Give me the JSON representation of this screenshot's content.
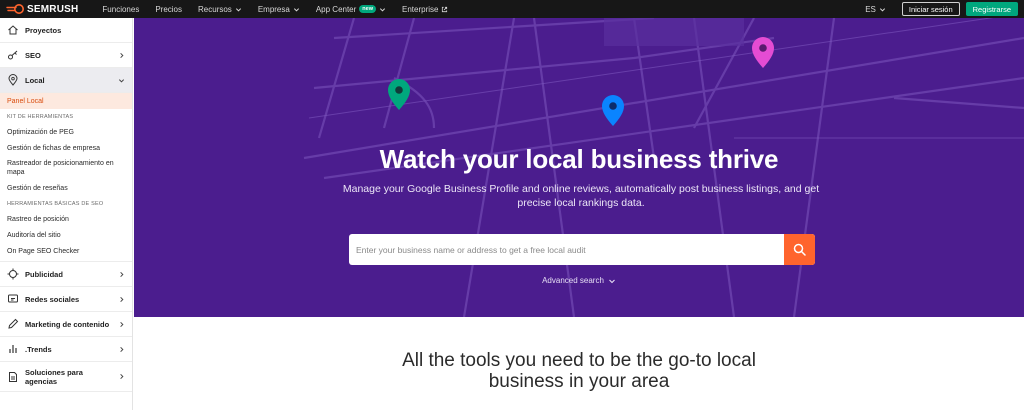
{
  "header": {
    "brand": "SEMRUSH",
    "nav": [
      {
        "label": "Funciones",
        "has_dropdown": false
      },
      {
        "label": "Precios",
        "has_dropdown": false
      },
      {
        "label": "Recursos",
        "has_dropdown": true
      },
      {
        "label": "Empresa",
        "has_dropdown": true
      },
      {
        "label": "App Center",
        "badge": "new",
        "has_dropdown": true
      },
      {
        "label": "Enterprise",
        "external": true
      }
    ],
    "language": "ES",
    "login_label": "Iniciar sesión",
    "register_label": "Registrarse"
  },
  "sidebar": {
    "proyectos": "Proyectos",
    "seo": "SEO",
    "local": "Local",
    "local_items": {
      "panel": "Panel Local",
      "kit_head": "KIT DE HERRAMIENTAS",
      "peg": "Optimización de PEG",
      "fichas": "Gestión de fichas de empresa",
      "rastreador": "Rastreador de posicionamiento en mapa",
      "resenas": "Gestión de reseñas",
      "basic_head": "HERRAMIENTAS BÁSICAS DE SEO",
      "rastreo": "Rastreo de posición",
      "auditoria": "Auditoría del sitio",
      "onpage": "On Page SEO Checker"
    },
    "publicidad": "Publicidad",
    "redes": "Redes sociales",
    "marketing": "Marketing de contenido",
    "trends": ".Trends",
    "soluciones": "Soluciones para agencias"
  },
  "hero": {
    "title": "Watch your local business thrive",
    "subtitle": "Manage your Google Business Profile and online reviews, automatically post business listings, and get precise local rankings data.",
    "search_placeholder": "Enter your business name or address to get a free local audit",
    "advanced_search": "Advanced search",
    "bg_color": "#4b1d8e",
    "accent": "#ff642d"
  },
  "tools": {
    "title_line1": "All the tools you need to be the go-to local",
    "title_line2": "business in your area"
  }
}
